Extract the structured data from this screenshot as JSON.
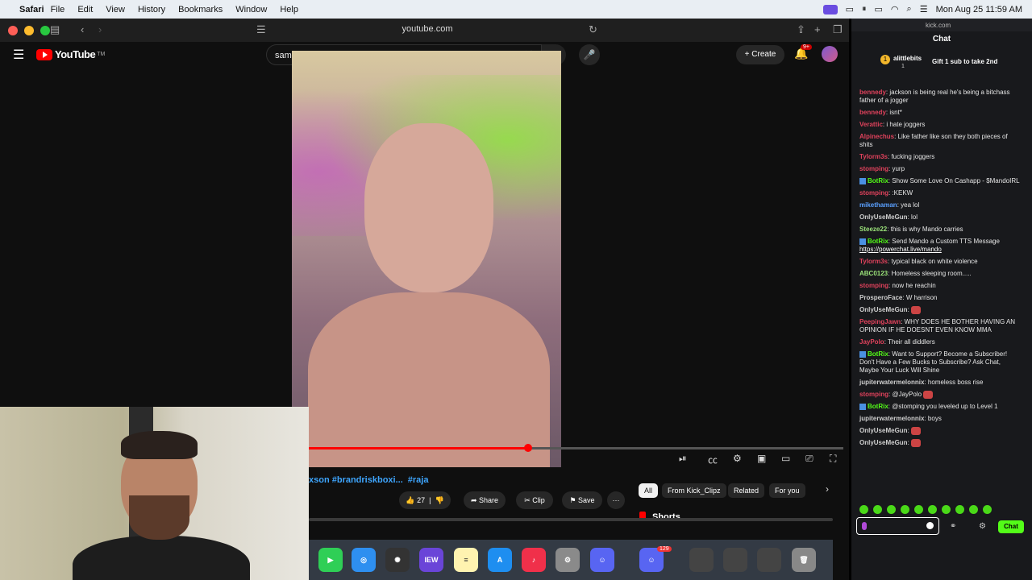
{
  "menubar": {
    "app": "Safari",
    "items": [
      "File",
      "Edit",
      "View",
      "History",
      "Bookmarks",
      "Window",
      "Help"
    ],
    "datetime": "Mon Aug 25  11:59 AM"
  },
  "browser": {
    "url": "youtube.com"
  },
  "youtube": {
    "logo": "YouTube",
    "logo_mark": "TM",
    "search_value": "samsung one ui 8 s25 ultra update",
    "create_label": "Create",
    "notif_badge": "9+",
    "video_progress": 0.41,
    "video_title": "xson #brandriskboxi...",
    "video_tag": "#raja",
    "likes": "27",
    "share_label": "Share",
    "clip_label": "Clip",
    "save_label": "Save",
    "more_label": "···",
    "chips": [
      "All",
      "From Kick_Clipz",
      "Related",
      "For you"
    ],
    "shorts_label": "Shorts"
  },
  "dock": {
    "badge": "129",
    "iew_label": "IEW"
  },
  "kick": {
    "url": "kick.com",
    "chat_title": "Chat",
    "pinned": {
      "rank": "1",
      "user": "alittlebits",
      "count": "1",
      "text": "Gift 1 sub to take 2nd"
    },
    "messages": [
      {
        "user": "bennedy",
        "text": "jackson is being real he's being a bitchass father of a jogger",
        "color": "#e0425c"
      },
      {
        "user": "bennedy",
        "text": "isnt*",
        "color": "#e0425c"
      },
      {
        "user": "Verattic",
        "text": "i hate joggers",
        "color": "#e0425c"
      },
      {
        "user": "Alpinechus",
        "text": "Like father like son they both pieces of shits",
        "color": "#e0425c"
      },
      {
        "user": "Tylorm3s",
        "text": "fucking joggers",
        "color": "#e0425c"
      },
      {
        "user": "stomping",
        "text": "yurp",
        "color": "#e0425c"
      },
      {
        "user": "BotRix",
        "text": "Show Some Love On Cashapp - $MandoIRL",
        "color": "#53fc18",
        "bot": true
      },
      {
        "user": "stomping",
        "text": ":KEKW",
        "color": "#e0425c"
      },
      {
        "user": "mikethaman",
        "text": "yea lol",
        "color": "#5aa0ff"
      },
      {
        "user": "OnlyUseMeGun",
        "text": "lol",
        "color": "#cfcfcf"
      },
      {
        "user": "Steeze22",
        "text": "this is why Mando carries",
        "color": "#9be37a"
      },
      {
        "user": "BotRix",
        "text": "Send Mando a Custom TTS Message",
        "link": "https://powerchat.live/mando",
        "color": "#53fc18",
        "bot": true
      },
      {
        "user": "Tylorm3s",
        "text": "typical black on white violence",
        "color": "#e0425c"
      },
      {
        "user": "ABC0123",
        "text": "Homeless sleeping room.....",
        "color": "#9be37a"
      },
      {
        "user": "stomping",
        "text": "now he reachin",
        "color": "#e0425c"
      },
      {
        "user": "ProsperoFace",
        "text": "W harrison",
        "color": "#cfcfcf"
      },
      {
        "user": "OnlyUseMeGun",
        "text": "",
        "color": "#cfcfcf",
        "emote": true
      },
      {
        "user": "PeepingJawn",
        "text": "WHY DOES HE BOTHER HAVING AN OPINION IF HE DOESNT EVEN KNOW MMA",
        "color": "#e0425c"
      },
      {
        "user": "JayPolo",
        "text": "Their all diddlers",
        "color": "#e0425c"
      },
      {
        "user": "BotRix",
        "text": "Want to Support? Become a Subscriber! Don't Have a Few Bucks to Subscribe? Ask Chat, Maybe Your Luck Will Shine",
        "color": "#53fc18",
        "bot": true
      },
      {
        "user": "jupiterwatermelonnix",
        "text": "homeless boss rise",
        "color": "#cfcfcf"
      },
      {
        "user": "stomping",
        "text": "@JayPolo",
        "color": "#e0425c",
        "emote": true
      },
      {
        "user": "BotRix",
        "text": "@stomping you leveled up to Level 1",
        "color": "#53fc18",
        "bot": true
      },
      {
        "user": "jupiterwatermelonnix",
        "text": "boys",
        "color": "#cfcfcf"
      },
      {
        "user": "OnlyUseMeGun",
        "text": "",
        "color": "#cfcfcf",
        "emote": true
      },
      {
        "user": "OnlyUseMeGun",
        "text": "",
        "color": "#cfcfcf",
        "emote": true
      }
    ],
    "chat_button": "Chat"
  }
}
